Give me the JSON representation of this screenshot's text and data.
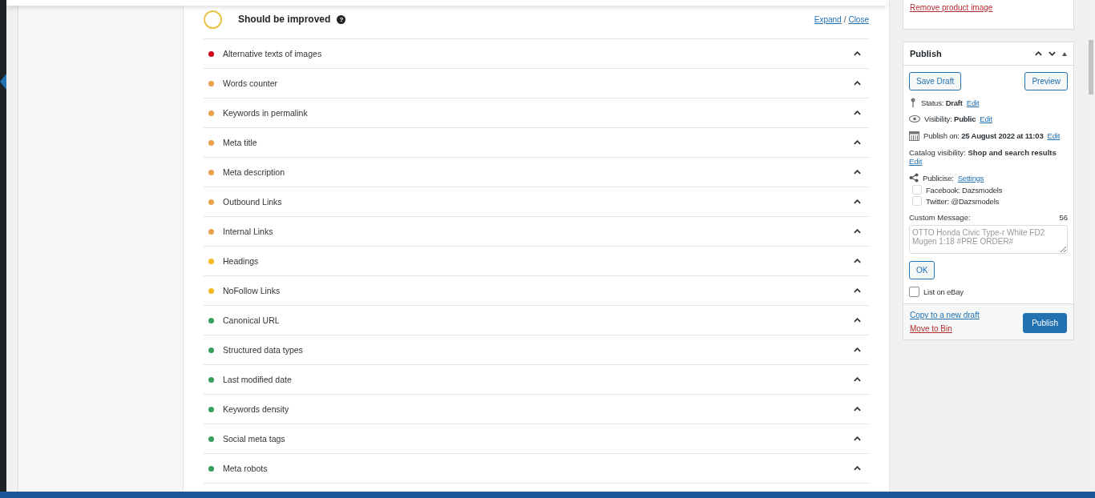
{
  "analysis": {
    "title": "Should be improved",
    "help": "?",
    "expand": "Expand",
    "separator": "/",
    "close": "Close",
    "checks": [
      {
        "label": "Alternative texts of images",
        "color": "#d0021b",
        "expanded": false
      },
      {
        "label": "Words counter",
        "color": "#e8a04a",
        "expanded": false
      },
      {
        "label": "Keywords in permalink",
        "color": "#e8a04a",
        "expanded": false
      },
      {
        "label": "Meta title",
        "color": "#e8a04a",
        "expanded": false
      },
      {
        "label": "Meta description",
        "color": "#e8a04a",
        "expanded": false
      },
      {
        "label": "Outbound Links",
        "color": "#e8a04a",
        "expanded": false
      },
      {
        "label": "Internal Links",
        "color": "#e8a04a",
        "expanded": false
      },
      {
        "label": "Headings",
        "color": "#f5b822",
        "expanded": false
      },
      {
        "label": "NoFollow Links",
        "color": "#f5b822",
        "expanded": false
      },
      {
        "label": "Canonical URL",
        "color": "#3a9e5f",
        "expanded": false
      },
      {
        "label": "Structured data types",
        "color": "#3a9e5f",
        "expanded": false
      },
      {
        "label": "Last modified date",
        "color": "#3a9e5f",
        "expanded": false
      },
      {
        "label": "Keywords density",
        "color": "#3a9e5f",
        "expanded": false
      },
      {
        "label": "Social meta tags",
        "color": "#3a9e5f",
        "expanded": false
      },
      {
        "label": "Meta robots",
        "color": "#3a9e5f",
        "expanded": false
      }
    ]
  },
  "product_image": {
    "remove_link": "Remove product image"
  },
  "publish": {
    "title": "Publish",
    "save_draft": "Save Draft",
    "preview": "Preview",
    "status": {
      "text": "Status: **Draft**",
      "link": "Edit"
    },
    "visibility": {
      "text": "Visibility: **Public**",
      "link": "Edit"
    },
    "publish_on": {
      "text": "Publish on: **25 August 2022 at 11:03**",
      "link": "Edit"
    },
    "catalog": {
      "text": "Catalog visibility: **Shop and search results**",
      "link": "Edit"
    },
    "publicise": {
      "label": "Publicise:",
      "link": "Settings"
    },
    "accounts": [
      {
        "label": "Facebook: Dazsmodels",
        "checked": false
      },
      {
        "label": "Twitter: @Dazsmodels",
        "checked": false
      }
    ],
    "custom_message": {
      "label": "Custom Message:",
      "count": "56",
      "placeholder": "OTTO Honda Civic Type-r White FD2 Mugen 1:18 #PRE ORDER#"
    },
    "ok": "OK",
    "list_on_ebay": {
      "label": "List on eBay",
      "checked": false
    },
    "copy_link": "Copy to a new draft",
    "bin_link": "Move to Bin",
    "publish_button": "Publish"
  }
}
